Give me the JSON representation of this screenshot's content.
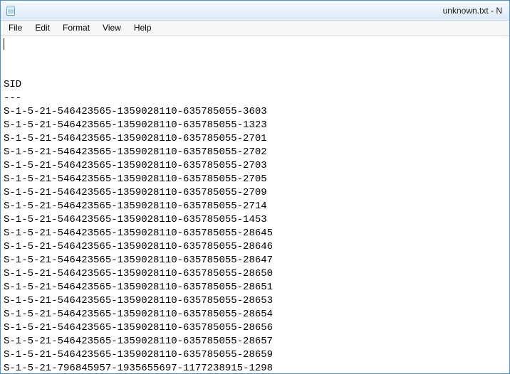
{
  "window": {
    "title": "unknown.txt - N"
  },
  "menu": {
    "file": "File",
    "edit": "Edit",
    "format": "Format",
    "view": "View",
    "help": "Help"
  },
  "document": {
    "header": "SID",
    "divider": "---",
    "lines": [
      "S-1-5-21-546423565-1359028110-635785055-3603",
      "S-1-5-21-546423565-1359028110-635785055-1323",
      "S-1-5-21-546423565-1359028110-635785055-2701",
      "S-1-5-21-546423565-1359028110-635785055-2702",
      "S-1-5-21-546423565-1359028110-635785055-2703",
      "S-1-5-21-546423565-1359028110-635785055-2705",
      "S-1-5-21-546423565-1359028110-635785055-2709",
      "S-1-5-21-546423565-1359028110-635785055-2714",
      "S-1-5-21-546423565-1359028110-635785055-1453",
      "S-1-5-21-546423565-1359028110-635785055-28645",
      "S-1-5-21-546423565-1359028110-635785055-28646",
      "S-1-5-21-546423565-1359028110-635785055-28647",
      "S-1-5-21-546423565-1359028110-635785055-28650",
      "S-1-5-21-546423565-1359028110-635785055-28651",
      "S-1-5-21-546423565-1359028110-635785055-28653",
      "S-1-5-21-546423565-1359028110-635785055-28654",
      "S-1-5-21-546423565-1359028110-635785055-28656",
      "S-1-5-21-546423565-1359028110-635785055-28657",
      "S-1-5-21-546423565-1359028110-635785055-28659",
      "S-1-5-21-796845957-1935655697-1177238915-1298"
    ]
  }
}
